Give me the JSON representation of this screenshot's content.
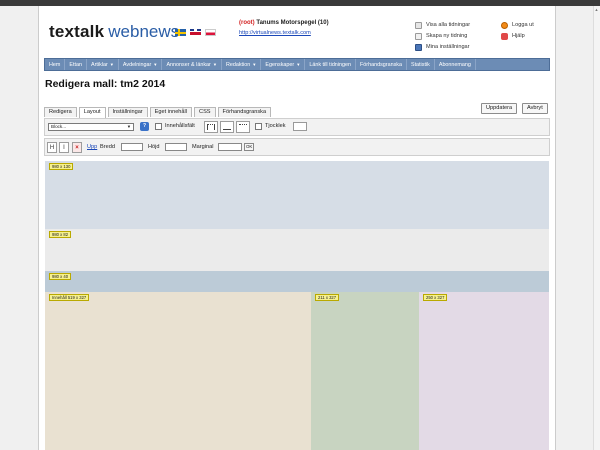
{
  "header": {
    "logo_bold": "textalk",
    "logo_light": "webnews",
    "site_root": "(root)",
    "site_name": "Tanums Motorspegel (10)",
    "site_url": "http://virtualnews.textalk.com",
    "quick_links": [
      "Visa alla tidningar",
      "Skapa ny tidning",
      "Mina inställningar"
    ],
    "account_links": [
      "Logga ut",
      "Hjälp"
    ]
  },
  "nav": {
    "items": [
      {
        "label": "Hem",
        "dropdown": false
      },
      {
        "label": "Ettan",
        "dropdown": false
      },
      {
        "label": "Artiklar",
        "dropdown": true
      },
      {
        "label": "Avdelningar",
        "dropdown": true
      },
      {
        "label": "Annonser & länkar",
        "dropdown": true
      },
      {
        "label": "Redaktion",
        "dropdown": true
      },
      {
        "label": "Egenskaper",
        "dropdown": true
      },
      {
        "label": "Länk till tidningen",
        "dropdown": false
      },
      {
        "label": "Förhandsgranska",
        "dropdown": false
      },
      {
        "label": "Statistik",
        "dropdown": false
      },
      {
        "label": "Abonnemang",
        "dropdown": false
      }
    ]
  },
  "page": {
    "title": "Redigera mall: tm2 2014"
  },
  "tabs": [
    "Redigera",
    "Layout",
    "Inställningar",
    "Eget innehåll",
    "CSS",
    "Förhandsgranska"
  ],
  "active_tab": "Layout",
  "actions": {
    "update_label": "Uppdatera",
    "cancel_label": "Avbryt"
  },
  "toolbar1": {
    "block_select_value": "Block...",
    "help_glyph": "?",
    "content_field_label": "Innehållsfält",
    "thickness_label": "Tjocklek"
  },
  "toolbar2": {
    "horizontal_split_glyph": "H",
    "center_glyph": "I",
    "delete_glyph": "×",
    "up_label": "Upp",
    "width_label": "Bredd",
    "height_label": "Höjd",
    "margin_label": "Marginal",
    "ok_label": "OK"
  },
  "layout_blocks": {
    "row1": "980 x 130",
    "row2": "980 x 82",
    "row3": "980 x 40",
    "main_col": "Innehåll 519 x 327",
    "mid_col": "211 x 327",
    "right_col": "250 x 327"
  },
  "colors": {
    "nav_bg": "#6c8cb5",
    "logo_accent": "#2a5da6",
    "root_red": "#d21f1f",
    "link_blue": "#1a47b8"
  }
}
